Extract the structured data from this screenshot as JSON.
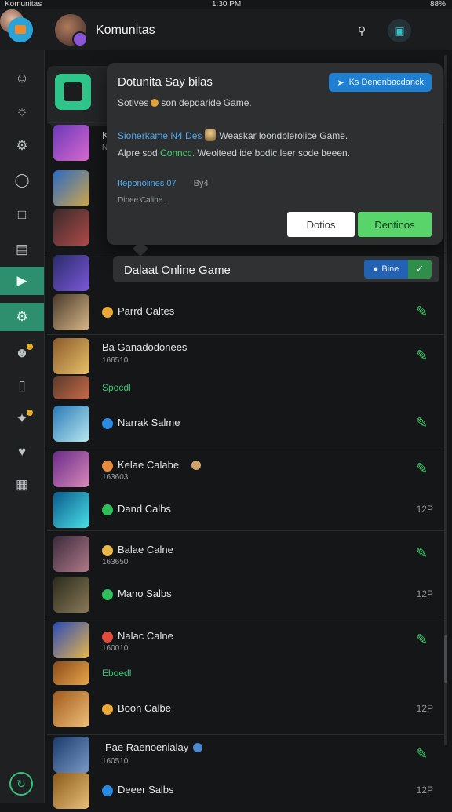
{
  "status_bar": {
    "left": "Komunitas",
    "center": "1:30 PM",
    "right": "88%"
  },
  "header": {
    "title": "Komunitas"
  },
  "popup": {
    "title": "Dotunita Say bilas",
    "subtitle_a": "Sotives",
    "subtitle_b": "son depdaride Game.",
    "pill_label": "Ks Denenbacdanck",
    "line1_blue": "Sionerkame N4 Des",
    "line1_rest": "Weaskar loondblerolice Game.",
    "line2_a": "Alpre sod",
    "line2_green": "Conncc.",
    "line2_b": "Weoiteed ide bodic leer sode beeen.",
    "line3_blue": "Iteponolines 07",
    "line3_by": "By4",
    "line4": "Dinee Caline.",
    "cancel_label": "Dotios",
    "ok_label": "Dentinos"
  },
  "banner": {
    "text": "Dalaat Online Game",
    "pill": "Bine"
  },
  "rows": {
    "r_k1": "K",
    "r_k2": "N",
    "r0": "Parrd Caltes",
    "g1_title": "Ba Ganadodonees",
    "g1_sub": "166510",
    "g1_green": "Spocdl",
    "g1_r2": "Narrak Salme",
    "g2_title": "Kelae Calabe",
    "g2_sub": "163603",
    "g2_r2": "Dand Calbs",
    "g2_num": "12P",
    "g3_title": "Balae Calne",
    "g3_sub": "163650",
    "g3_r2": "Mano Salbs",
    "g3_num": "12P",
    "g4_title": "Nalac Calne",
    "g4_sub": "160010",
    "g4_green": "Eboedl",
    "g4_r2": "Boon Calbe",
    "g4_num": "12P",
    "g5_title": "Pae Raenoenialay",
    "g5_sub": "160510",
    "g5_r2": "Deeer Salbs",
    "g5_num": "12P"
  }
}
